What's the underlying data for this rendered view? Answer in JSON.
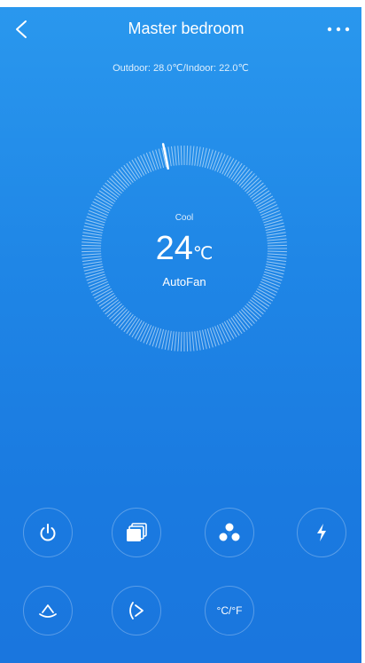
{
  "header": {
    "title": "Master bedroom"
  },
  "status": {
    "readout": "Outdoor: 28.0℃/Indoor: 22.0℃"
  },
  "dial": {
    "mode": "Cool",
    "temperature": "24",
    "unit": "℃",
    "fan": "AutoFan",
    "level": 0.0
  },
  "controls": {
    "unit_toggle_label": "°C/°F"
  },
  "colors": {
    "background_top": "#2a98ee",
    "background_bottom": "#1a76de",
    "foreground": "#ffffff"
  },
  "icons": [
    "back-icon",
    "more-icon",
    "power-icon",
    "mode-icon",
    "fan-icon",
    "turbo-icon",
    "swing-vertical-icon",
    "swing-horizontal-icon"
  ]
}
